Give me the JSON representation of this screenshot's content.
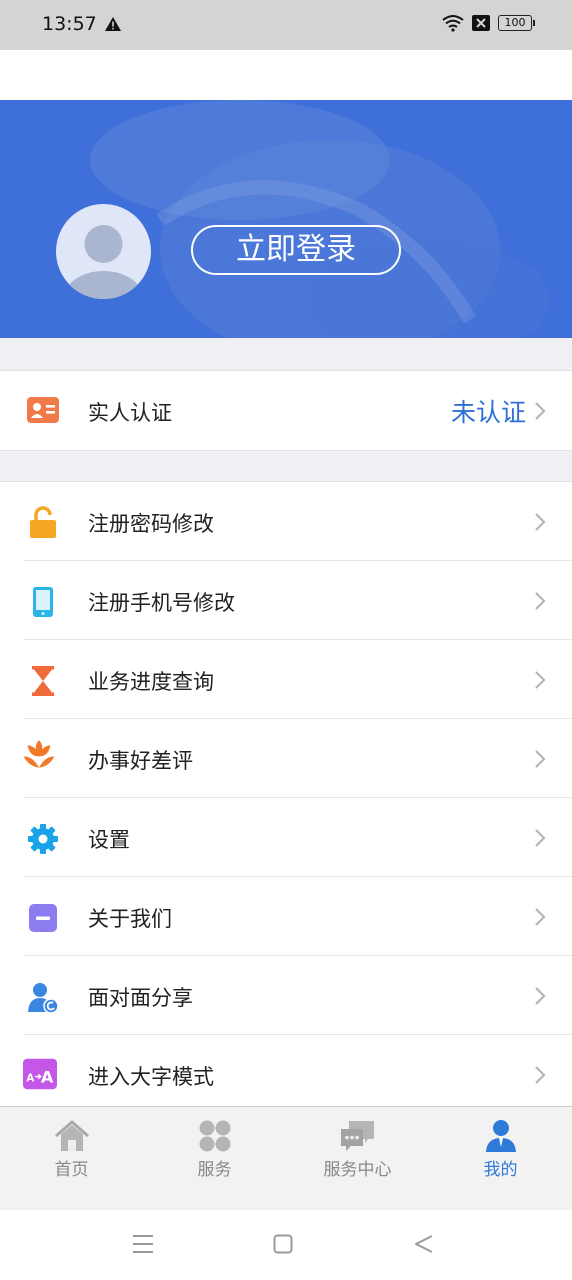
{
  "status_bar": {
    "time": "13:57",
    "battery": "100"
  },
  "profile": {
    "login_label": "立即登录"
  },
  "verify": {
    "label": "实人认证",
    "status": "未认证",
    "status_color": "#2f6fd8"
  },
  "menu": [
    {
      "label": "注册密码修改",
      "icon": "lock-icon"
    },
    {
      "label": "注册手机号修改",
      "icon": "phone-icon"
    },
    {
      "label": "业务进度查询",
      "icon": "hourglass-icon"
    },
    {
      "label": "办事好差评",
      "icon": "flower-icon"
    },
    {
      "label": "设置",
      "icon": "gear-icon"
    },
    {
      "label": "关于我们",
      "icon": "info-card-icon"
    },
    {
      "label": "面对面分享",
      "icon": "share-person-icon"
    },
    {
      "label": "进入大字模式",
      "icon": "large-font-icon"
    }
  ],
  "tabs": [
    {
      "label": "首页",
      "icon": "home-icon"
    },
    {
      "label": "服务",
      "icon": "services-grid-icon"
    },
    {
      "label": "服务中心",
      "icon": "chat-bubbles-icon"
    },
    {
      "label": "我的",
      "icon": "person-icon",
      "active": true
    }
  ],
  "accent_color": "#3f6fd8"
}
